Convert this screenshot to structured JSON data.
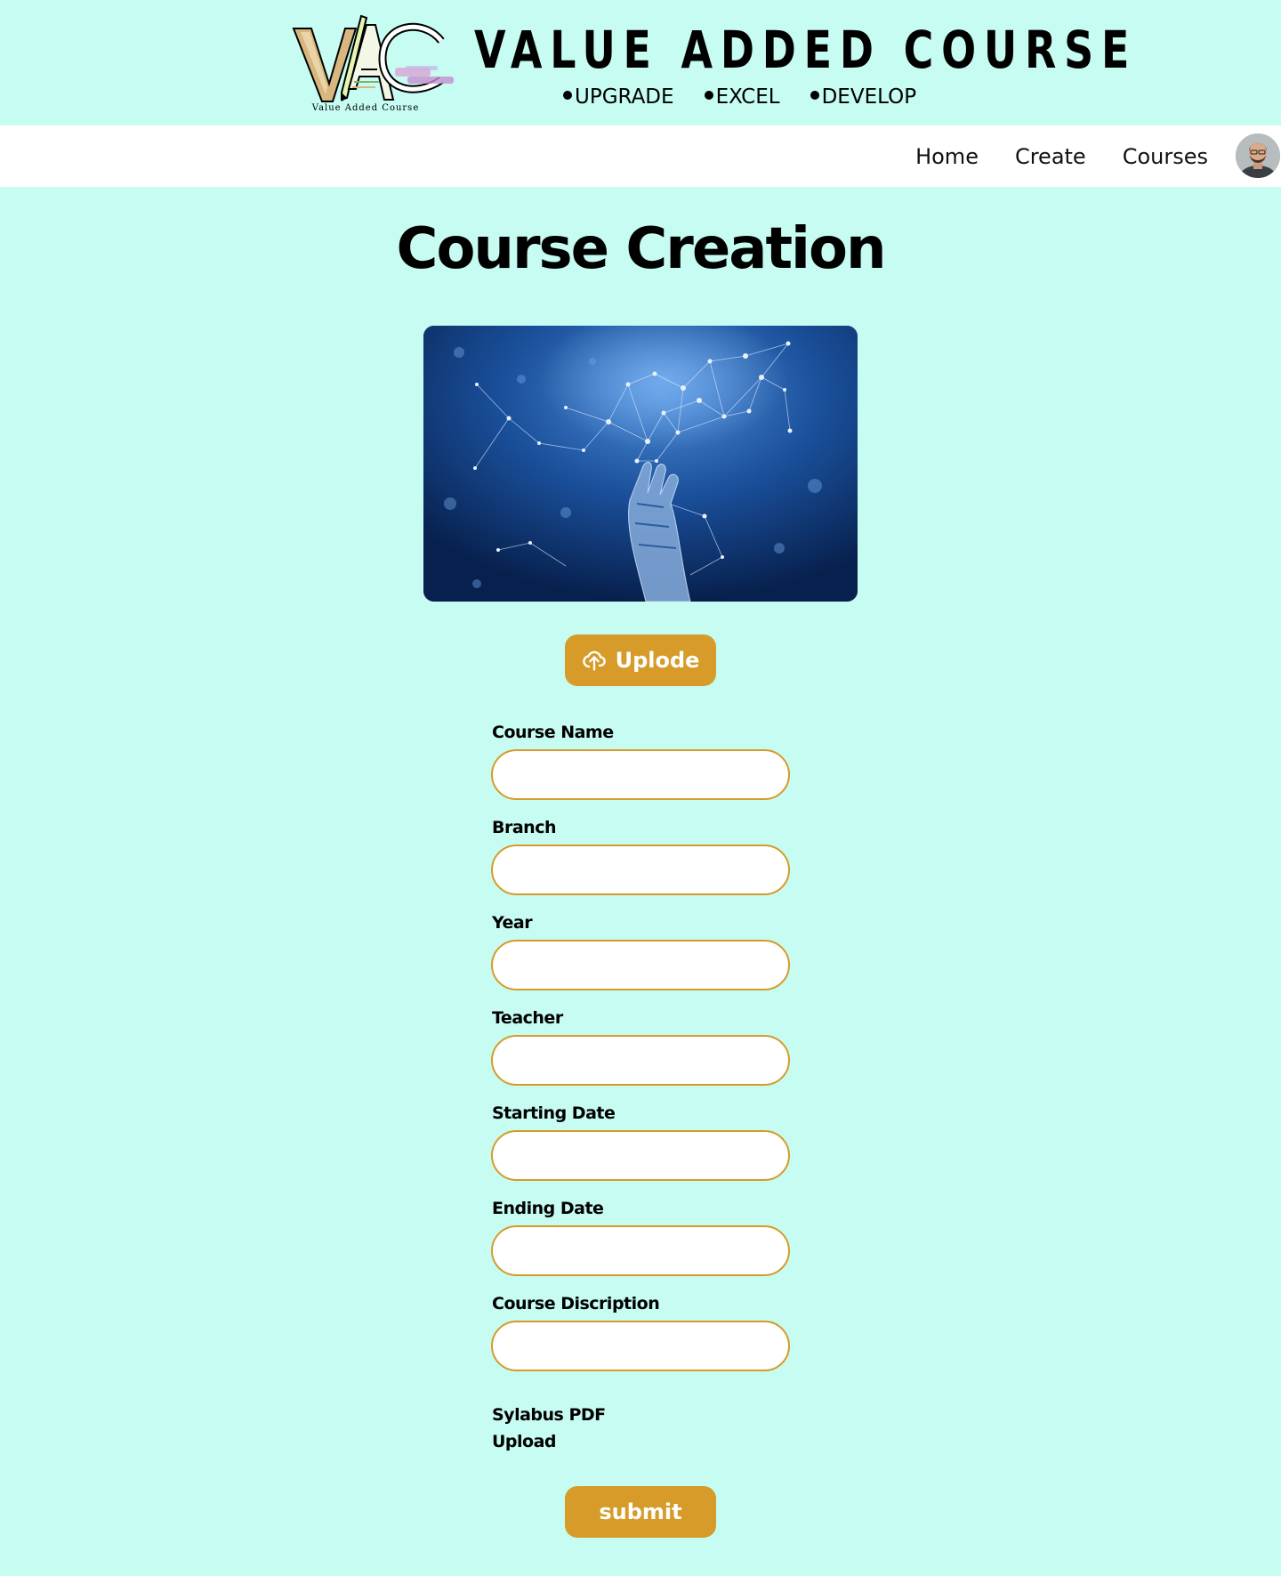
{
  "header": {
    "logo_caption": "Value Added Course",
    "site_title": "VALUE ADDED COURSE",
    "taglines": [
      "UPGRADE",
      "EXCEL",
      "DEVELOP"
    ]
  },
  "nav": {
    "links": [
      "Home",
      "Create",
      "Courses"
    ]
  },
  "main": {
    "title": "Course Creation",
    "upload_label": "Uplode",
    "fields": [
      {
        "label": "Course Name",
        "value": ""
      },
      {
        "label": "Branch",
        "value": ""
      },
      {
        "label": "Year",
        "value": ""
      },
      {
        "label": "Teacher",
        "value": ""
      },
      {
        "label": "Starting Date",
        "value": ""
      },
      {
        "label": "Ending Date",
        "value": ""
      },
      {
        "label": "Course Discription",
        "value": ""
      }
    ],
    "syllabus_label": "Sylabus PDF Upload",
    "submit_label": "submit"
  },
  "colors": {
    "background": "#c6fcf1",
    "accent": "#d69b28",
    "navbar": "#ffffff"
  }
}
